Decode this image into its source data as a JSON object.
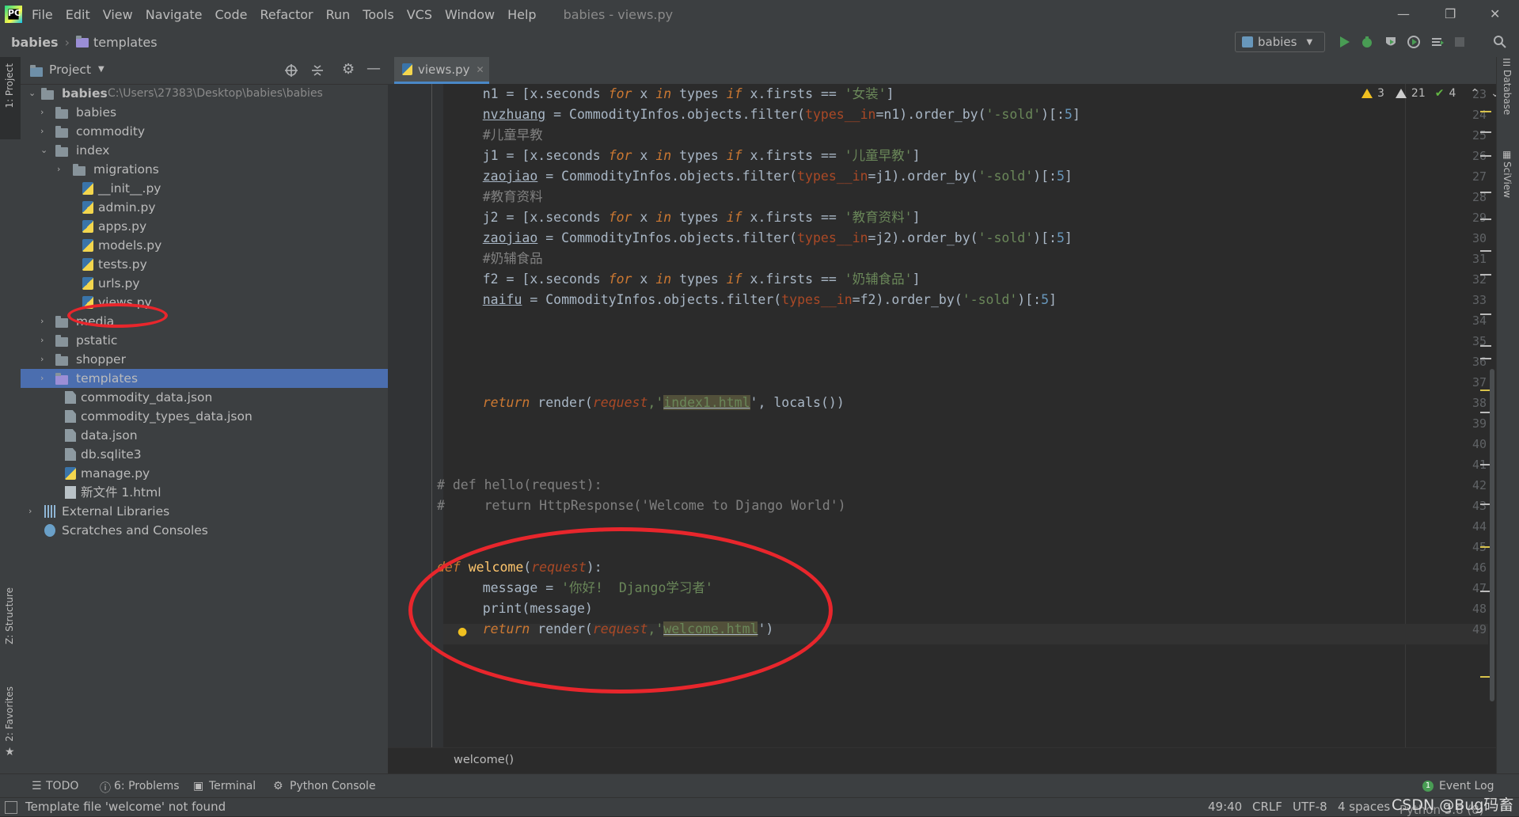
{
  "menubar": {
    "items": [
      "File",
      "Edit",
      "View",
      "Navigate",
      "Code",
      "Refactor",
      "Run",
      "Tools",
      "VCS",
      "Window",
      "Help"
    ],
    "window_title": "babies - views.py"
  },
  "navbar": {
    "project": "babies",
    "folder": "templates",
    "run_config": "babies"
  },
  "left_strip": {
    "project_tab": "1: Project",
    "structure_tab": "Z: Structure",
    "favorites_tab": "2: Favorites"
  },
  "right_strip": {
    "database_tab": "Database",
    "sciview_tab": "SciView"
  },
  "project_panel": {
    "title": "Project",
    "tree": [
      {
        "label": "babies",
        "path": "C:\\Users\\27383\\Desktop\\babies\\babies",
        "level": 0,
        "type": "folder",
        "expanded": true
      },
      {
        "label": "babies",
        "level": 1,
        "type": "folder"
      },
      {
        "label": "commodity",
        "level": 1,
        "type": "folder"
      },
      {
        "label": "index",
        "level": 1,
        "type": "folder",
        "expanded": true
      },
      {
        "label": "migrations",
        "level": 2,
        "type": "folder"
      },
      {
        "label": "__init__.py",
        "level": 2,
        "type": "py"
      },
      {
        "label": "admin.py",
        "level": 2,
        "type": "py"
      },
      {
        "label": "apps.py",
        "level": 2,
        "type": "py"
      },
      {
        "label": "models.py",
        "level": 2,
        "type": "py"
      },
      {
        "label": "tests.py",
        "level": 2,
        "type": "py"
      },
      {
        "label": "urls.py",
        "level": 2,
        "type": "py"
      },
      {
        "label": "views.py",
        "level": 2,
        "type": "py"
      },
      {
        "label": "media",
        "level": 1,
        "type": "folder"
      },
      {
        "label": "pstatic",
        "level": 1,
        "type": "folder"
      },
      {
        "label": "shopper",
        "level": 1,
        "type": "folder"
      },
      {
        "label": "templates",
        "level": 1,
        "type": "folder-purple",
        "selected": true
      },
      {
        "label": "commodity_data.json",
        "level": 1,
        "type": "file"
      },
      {
        "label": "commodity_types_data.json",
        "level": 1,
        "type": "file"
      },
      {
        "label": "data.json",
        "level": 1,
        "type": "file"
      },
      {
        "label": "db.sqlite3",
        "level": 1,
        "type": "file"
      },
      {
        "label": "manage.py",
        "level": 1,
        "type": "py"
      },
      {
        "label": "新文件 1.html",
        "level": 1,
        "type": "html"
      },
      {
        "label": "External Libraries",
        "level": 0,
        "type": "lib"
      },
      {
        "label": "Scratches and Consoles",
        "level": 0,
        "type": "scratch"
      }
    ]
  },
  "editor": {
    "tab": "views.py",
    "inspections": {
      "warnings": "3",
      "weak_warnings": "21",
      "typos": "4"
    },
    "breadcrumb": "welcome()",
    "lines": [
      {
        "n": "23"
      },
      {
        "n": "24"
      },
      {
        "n": "25"
      },
      {
        "n": "26"
      },
      {
        "n": "27"
      },
      {
        "n": "28"
      },
      {
        "n": "29"
      },
      {
        "n": "30"
      },
      {
        "n": "31"
      },
      {
        "n": "32"
      },
      {
        "n": "33"
      },
      {
        "n": "34"
      },
      {
        "n": "35"
      },
      {
        "n": "36"
      },
      {
        "n": "37"
      },
      {
        "n": "38"
      },
      {
        "n": "39"
      },
      {
        "n": "40"
      },
      {
        "n": "41"
      },
      {
        "n": "42"
      },
      {
        "n": "43"
      },
      {
        "n": "44"
      },
      {
        "n": "45"
      },
      {
        "n": "46"
      },
      {
        "n": "47"
      },
      {
        "n": "48"
      },
      {
        "n": "49"
      }
    ],
    "code": {
      "l23": {
        "a": "    n1 = [x.seconds ",
        "for": "for",
        " x ": " x ",
        "in": "in",
        " types ": " types ",
        "if": "if",
        " x.firsts == ": " x.firsts == ",
        "s": "'女装'",
        "e": "]"
      },
      "l24": {
        "v": "nvzhuang",
        "a": " = CommodityInfos.objects.filter(",
        "k": "types__in",
        "b": "=n1).order_by(",
        "s": "'-sold'",
        "c": ")[:",
        "num": "5",
        "e": "]"
      },
      "l25": "#儿童早教",
      "l26": {
        "a": "    j1 = [x.seconds ",
        "s": "'儿童早教'"
      },
      "l27": {
        "v": "zaojiao",
        "a": " = CommodityInfos.objects.filter(",
        "k": "types__in",
        "b": "=j1).order_by(",
        "s": "'-sold'",
        "c": ")[:",
        "num": "5",
        "e": "]"
      },
      "l28": "#教育资料",
      "l29": {
        "a": "    j2 = [x.seconds ",
        "s": "'教育资料'"
      },
      "l30": {
        "v": "zaojiao",
        "a": " = CommodityInfos.objects.filter(",
        "k": "types__in",
        "b": "=j2).order_by(",
        "s": "'-sold'",
        "c": ")[:",
        "num": "5",
        "e": "]"
      },
      "l31": "#奶辅食品",
      "l32": {
        "a": "    f2 = [x.seconds ",
        "s": "'奶辅食品'"
      },
      "l33": {
        "v": "naifu",
        "a": " = CommodityInfos.objects.filter(",
        "k": "types__in",
        "b": "=f2).order_by(",
        "s": "'-sold'",
        "c": ")[:",
        "num": "5",
        "e": "]"
      },
      "l38": {
        "ret": "return",
        "a": " render(",
        "p": "request",
        "b": ",'",
        "s": "index1.html",
        "c": "', locals())"
      },
      "l42": "# def hello(request):",
      "l43": "#     return HttpResponse('Welcome to Django World')",
      "l46": {
        "def": "def",
        "fn": "welcome",
        "p": "request"
      },
      "l47": {
        "a": "    message = ",
        "s": "'你好!  Django学习者'"
      },
      "l48": "    print(message)",
      "l49": {
        "ret": "return",
        "a": " render(",
        "p": "request",
        "b": ",'",
        "s": "welcome.html",
        "c": "')"
      }
    }
  },
  "toolwindows": {
    "todo": "TODO",
    "problems": "6: Problems",
    "terminal": "Terminal",
    "python_console": "Python Console",
    "event_log": "Event Log",
    "event_count": "1"
  },
  "statusbar": {
    "message": "Template file 'welcome' not found",
    "position": "49:40",
    "line_sep": "CRLF",
    "encoding": "UTF-8",
    "indent": "4 spaces",
    "interpreter": "Python 3.8 (8)",
    "watermark": "CSDN @Bug码畜"
  },
  "colors": {
    "selection": "#4b6eaf",
    "annotation": "#e8262c",
    "keyword": "#cc7832",
    "string": "#6a8759"
  }
}
